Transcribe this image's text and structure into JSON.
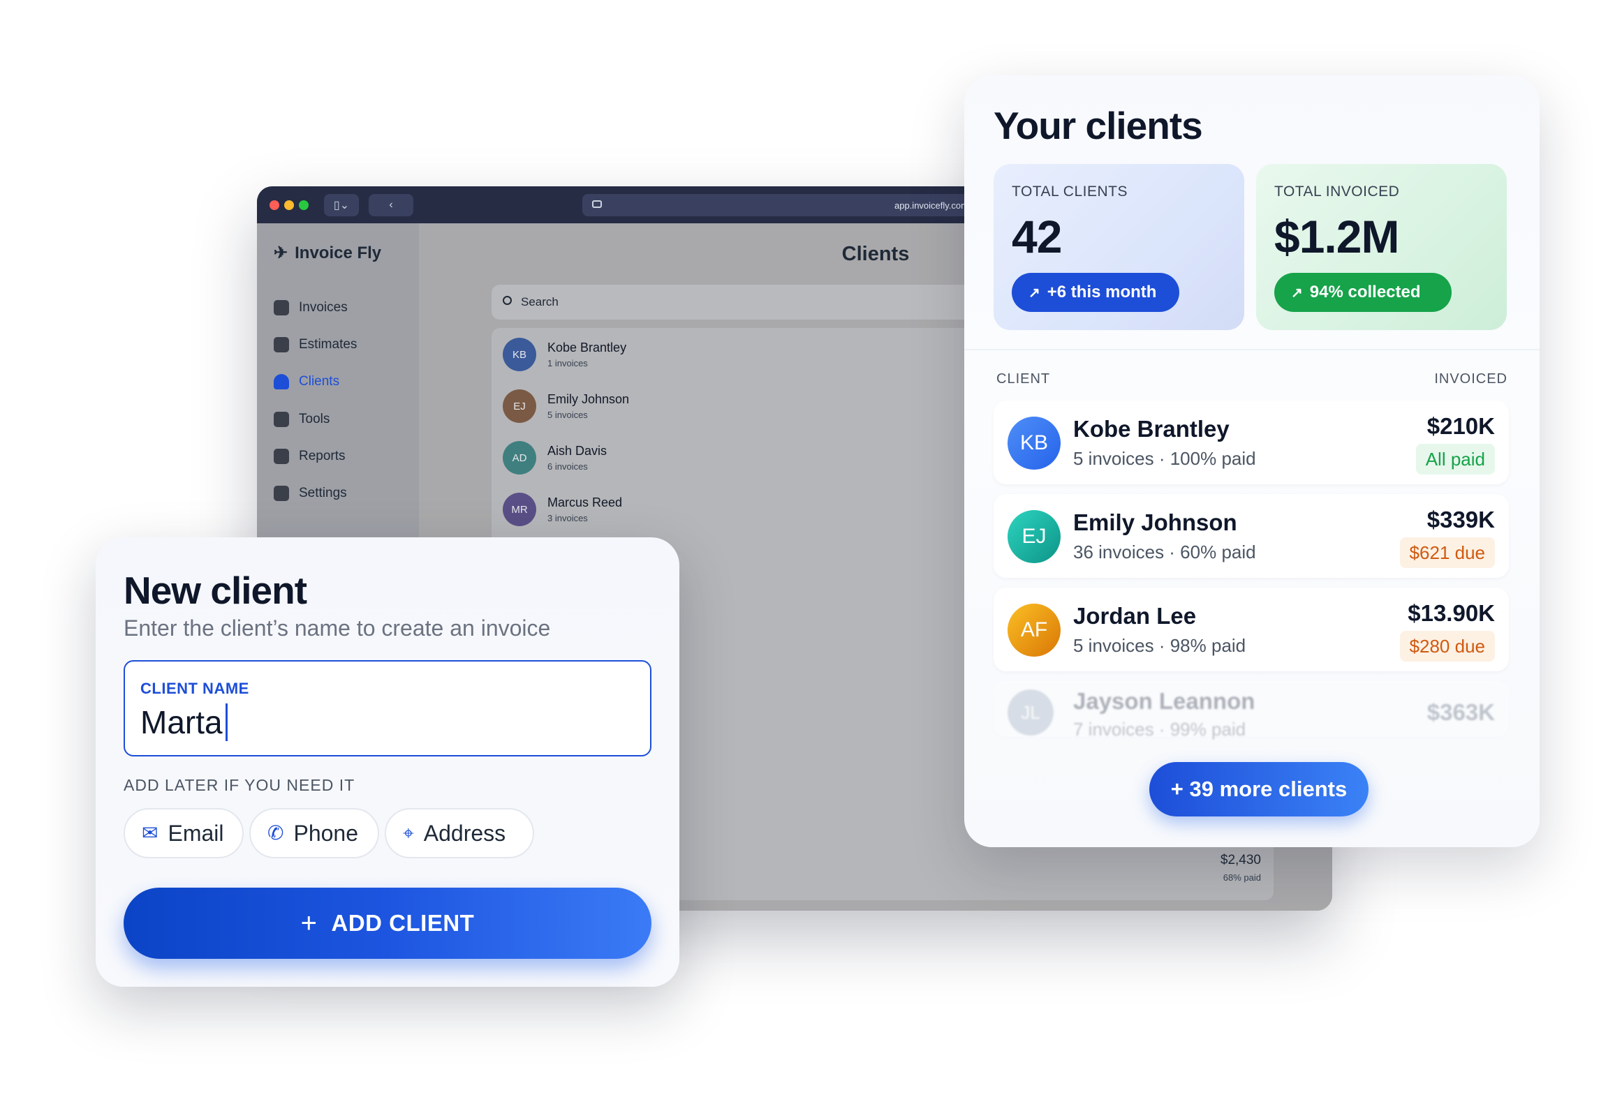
{
  "browser": {
    "url": "app.invoicefly.com",
    "brand": "Invoice Fly",
    "nav": [
      {
        "label": "Invoices",
        "icon": "document-icon"
      },
      {
        "label": "Estimates",
        "icon": "estimate-icon"
      },
      {
        "label": "Clients",
        "icon": "person-icon",
        "active": true
      },
      {
        "label": "Tools",
        "icon": "grid-icon"
      },
      {
        "label": "Reports",
        "icon": "bar-chart-icon"
      },
      {
        "label": "Settings",
        "icon": "gear-icon"
      }
    ],
    "page_title": "Clients",
    "search_placeholder": "Search",
    "rows": [
      {
        "initials": "KB",
        "name": "Kobe Brantley",
        "sub": "1 invoices",
        "color": "#3a5a9a"
      },
      {
        "initials": "EJ",
        "name": "Emily Johnson",
        "sub": "5 invoices",
        "color": "#7a5a44"
      },
      {
        "initials": "AD",
        "name": "Aish Davis",
        "sub": "6 invoices",
        "color": "#3f7f7f"
      },
      {
        "initials": "MR",
        "name": "Marcus Reed",
        "sub": "3 invoices",
        "color": "#5a4f86"
      }
    ],
    "footer_amount": "$2,430",
    "footer_sub": "68% paid"
  },
  "clients_card": {
    "title": "Your clients",
    "total_clients": {
      "label": "TOTAL CLIENTS",
      "value": "42",
      "pill": "+6 this month"
    },
    "total_invoiced": {
      "label": "TOTAL INVOICED",
      "value": "$1.2M",
      "pill": "94% collected"
    },
    "col_client": "CLIENT",
    "col_invoiced": "INVOICED",
    "clients": [
      {
        "initials": "KB",
        "name": "Kobe Brantley",
        "sub": "5 invoices · 100% paid",
        "amount": "$210K",
        "badge": "All paid",
        "badge_type": "paid",
        "color": "#3b82f6"
      },
      {
        "initials": "EJ",
        "name": "Emily Johnson",
        "sub": "36 invoices · 60% paid",
        "amount": "$339K",
        "badge": "$621 due",
        "badge_type": "due",
        "color": "#14b8a6"
      },
      {
        "initials": "AF",
        "name": "Jordan Lee",
        "sub": "5 invoices · 98% paid",
        "amount": "$13.90K",
        "badge": "$280 due",
        "badge_type": "due",
        "color": "#f59e0b"
      },
      {
        "initials": "JL",
        "name": "Jayson Leannon",
        "sub": "7 invoices · 99% paid",
        "amount": "$363K",
        "color": "#94a3b8"
      }
    ],
    "more_button": "+ 39 more clients"
  },
  "new_client": {
    "title": "New client",
    "subtitle": "Enter the client’s name to create an invoice",
    "field_label": "CLIENT NAME",
    "field_value": "Marta",
    "later_label": "ADD LATER IF YOU NEED IT",
    "chips": [
      {
        "label": "Email",
        "icon": "envelope-icon"
      },
      {
        "label": "Phone",
        "icon": "phone-icon"
      },
      {
        "label": "Address",
        "icon": "location-pin-icon"
      }
    ],
    "add_button": "ADD CLIENT"
  },
  "colors": {
    "accent_blue": "#1d4ed8",
    "accent_green": "#16a34a",
    "due_orange": "#d05a0f"
  }
}
